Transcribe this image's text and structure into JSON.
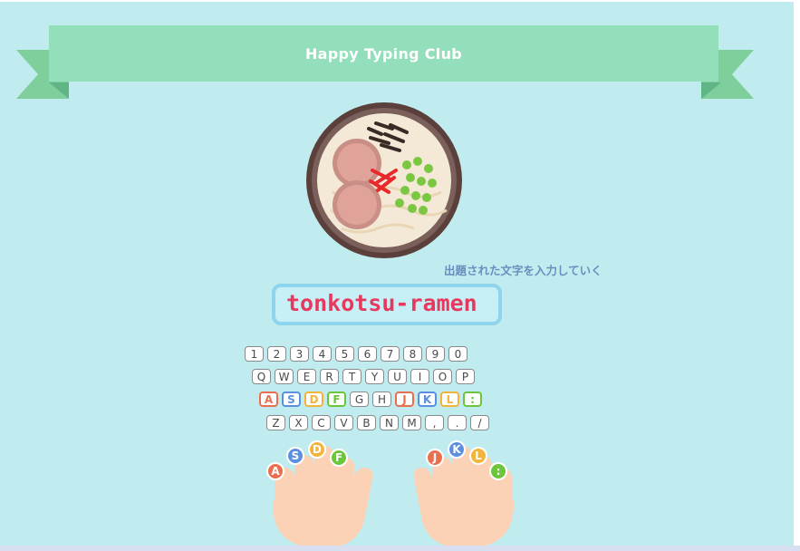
{
  "app": {
    "title": "Happy Typing Club"
  },
  "illustration": {
    "name": "tonkotsu ramen bowl"
  },
  "hint_text": "出題された文字を入力していく",
  "target_word": "tonkotsu-ramen",
  "keyboard": {
    "rows": [
      [
        "1",
        "2",
        "3",
        "4",
        "5",
        "6",
        "7",
        "8",
        "9",
        "0"
      ],
      [
        "Q",
        "W",
        "E",
        "R",
        "T",
        "Y",
        "U",
        "I",
        "O",
        "P"
      ],
      [
        "A",
        "S",
        "D",
        "F",
        "G",
        "H",
        "J",
        "K",
        "L",
        ":"
      ],
      [
        "Z",
        "X",
        "C",
        "V",
        "B",
        "N",
        "M",
        ",",
        ".",
        "/"
      ]
    ],
    "home_keys": {
      "A": "#e96f4f",
      "S": "#5b8fe0",
      "D": "#f3b43a",
      "F": "#6cc63c",
      "J": "#e96f4f",
      "K": "#5b8fe0",
      "L": "#f3b43a",
      ":": "#6cc63c"
    }
  },
  "hands": {
    "left_fingers": [
      "A",
      "S",
      "D",
      "F"
    ],
    "right_fingers": [
      "J",
      "K",
      "L",
      ":"
    ]
  },
  "colors": {
    "background": "#c1ecef",
    "ribbon": "#93dfbb",
    "word": "#e8385d",
    "hint": "#6a8fbf"
  }
}
